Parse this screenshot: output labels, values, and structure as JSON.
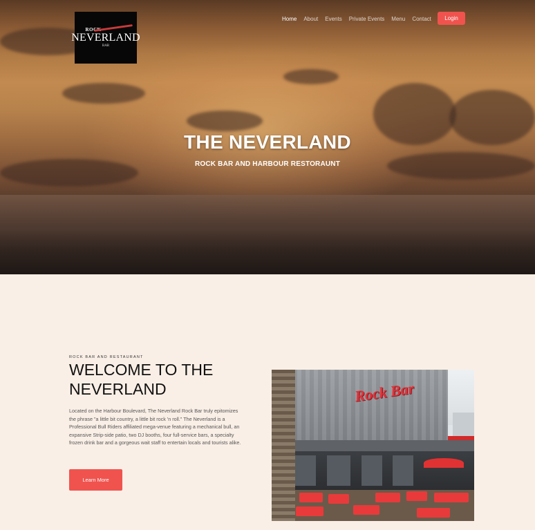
{
  "logo": {
    "line1": "ROCK",
    "line2": "NEVERLAND",
    "line3": "BAR"
  },
  "nav": {
    "items": [
      "Home",
      "About",
      "Events",
      "Private Events",
      "Menu",
      "Contact"
    ],
    "active": "Home",
    "login_label": "Login"
  },
  "hero": {
    "title": "THE NEVERLAND",
    "subtitle": "ROCK BAR AND HARBOUR RESTORAUNT"
  },
  "welcome": {
    "eyebrow": "ROCK BAR AND RESTAURANT",
    "heading": "WELCOME TO THE NEVERLAND",
    "description": "Located on the Harbour Boulevard, The Neverland Rock Bar truly epitomizes the phrase \"a little bit country, a little bit rock 'n roll.\" The Neverland is a Professional Bull Riders affiliated mega-venue featuring a mechanical bull, an expansive Strip-side patio, two DJ booths, four full-service bars, a specialty frozen drink bar and a gorgeous wait staff to entertain locals and tourists alike.",
    "button_label": "Learn More"
  },
  "photo": {
    "sign_text": "Rock Bar"
  },
  "colors": {
    "accent": "#f0534e",
    "background": "#f9efe6"
  }
}
